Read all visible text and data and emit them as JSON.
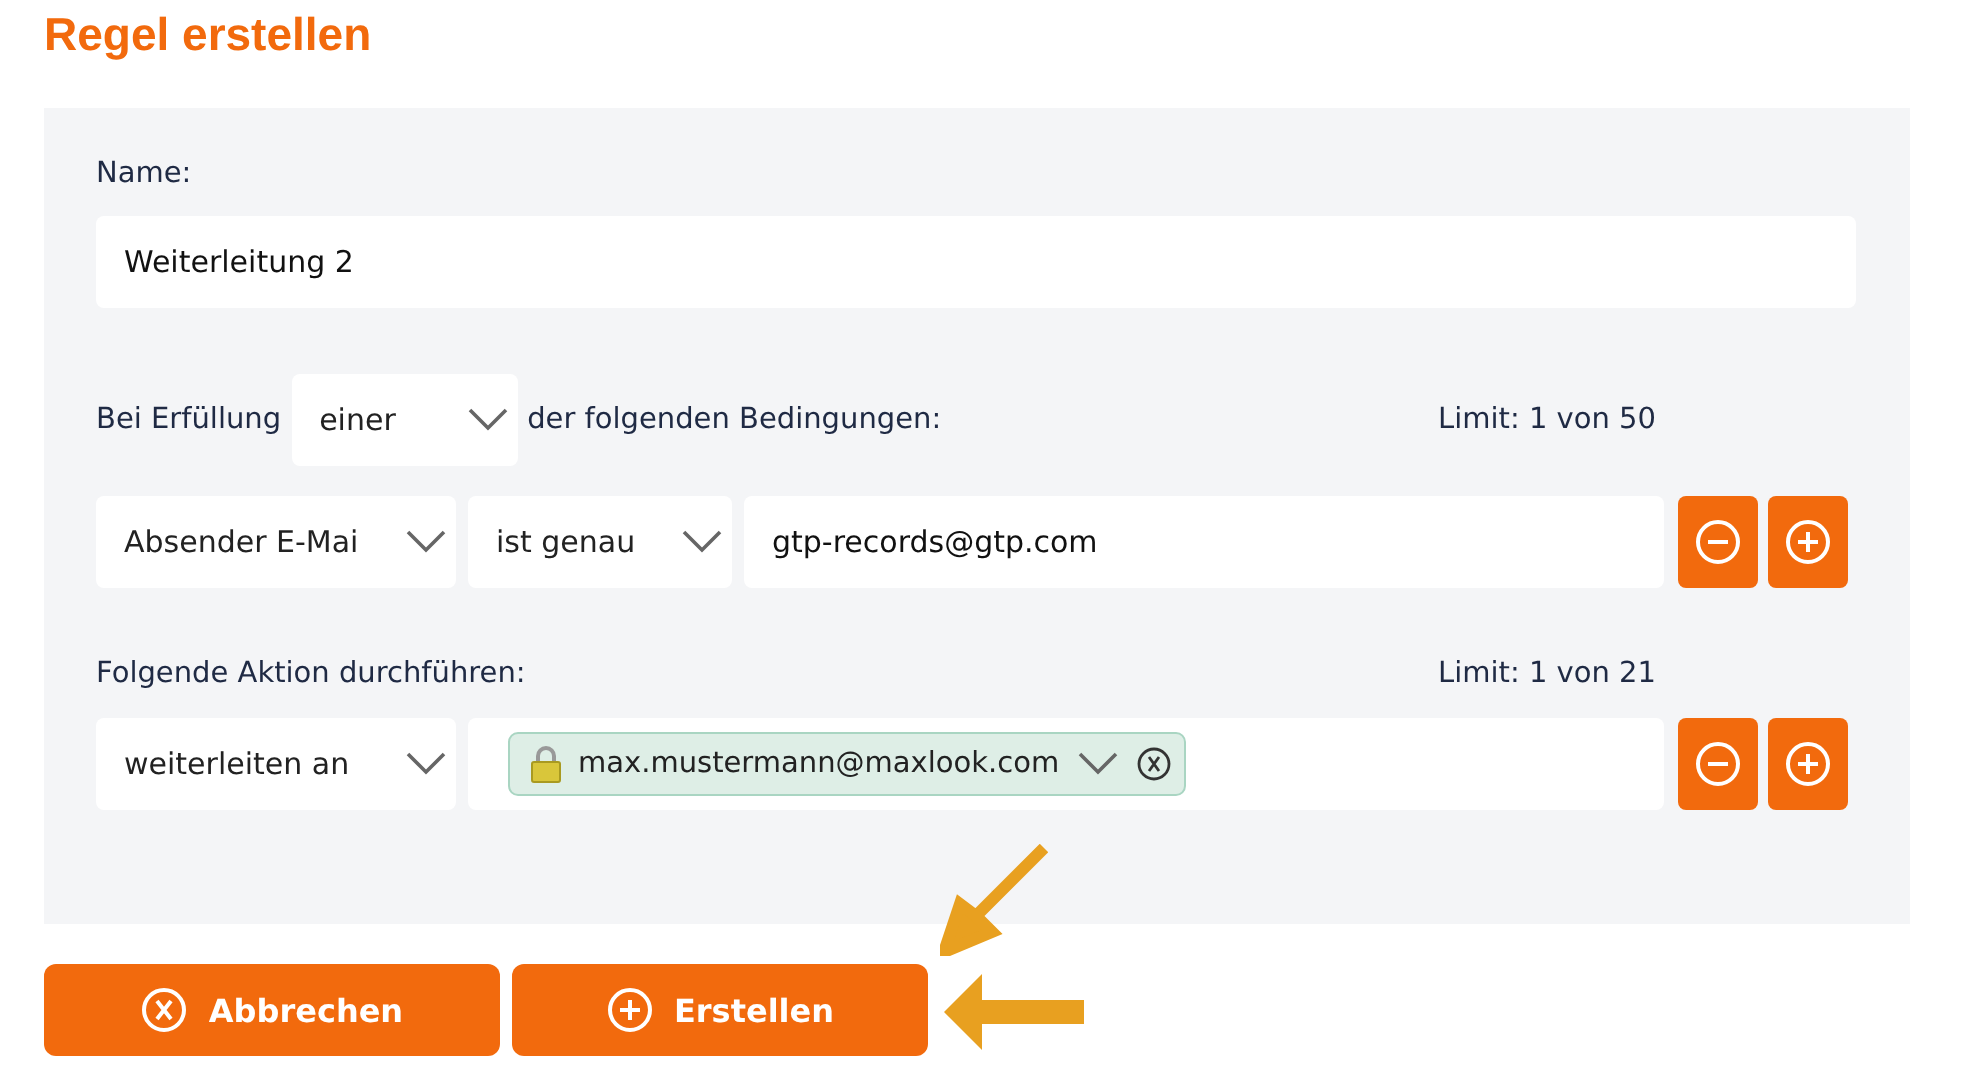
{
  "title": "Regel erstellen",
  "name_field": {
    "label": "Name:",
    "value": "Weiterleitung 2"
  },
  "conditions": {
    "prefix": "Bei Erfüllung",
    "match": "einer",
    "suffix": "der folgenden Bedingungen:",
    "limit": "Limit: 1 von 50",
    "rows": [
      {
        "field": "Absender E-Mai",
        "operator": "ist genau",
        "value": "gtp-records@gtp.com"
      }
    ]
  },
  "actions": {
    "label": "Folgende Aktion durchführen:",
    "limit": "Limit: 1 von 21",
    "rows": [
      {
        "action": "weiterleiten an",
        "targets": [
          {
            "label": "max.mustermann@maxlook.com",
            "locked": true
          }
        ]
      }
    ]
  },
  "buttons": [
    {
      "label": "Abbrechen",
      "kind": "cancel"
    },
    {
      "label": "Erstellen",
      "kind": "create"
    }
  ]
}
